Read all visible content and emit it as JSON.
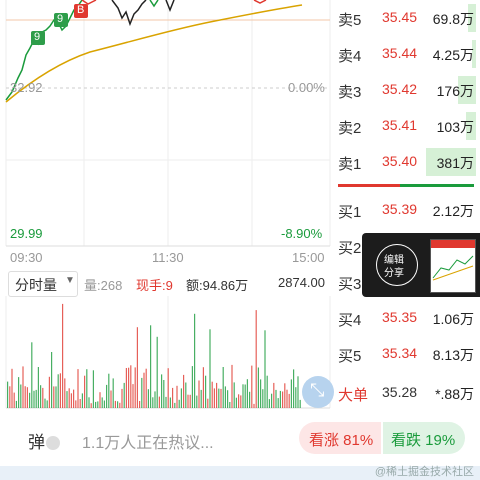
{
  "chart": {
    "left_price_mid": "32.92",
    "right_pct_mid": "0.00%",
    "left_price_low": "29.99",
    "right_pct_low": "-8.90%",
    "marker_9": "9",
    "marker_b": "B",
    "time_labels": [
      "09:30",
      "11:30",
      "15:00"
    ]
  },
  "volume_header": {
    "selector_label": "分时量",
    "vol_label": "量:268",
    "current_hand_label": "现手:9",
    "amount_label": "额:94.86万",
    "max_label": "2874.00"
  },
  "order_book": {
    "asks": [
      {
        "side": "卖5",
        "price": "35.45",
        "volume": "69.8万",
        "bar_fraction": 0.05
      },
      {
        "side": "卖4",
        "price": "35.44",
        "volume": "4.25万",
        "bar_fraction": 0.03
      },
      {
        "side": "卖3",
        "price": "35.42",
        "volume": "176万",
        "bar_fraction": 0.12
      },
      {
        "side": "卖2",
        "price": "35.41",
        "volume": "103万",
        "bar_fraction": 0.07
      },
      {
        "side": "卖1",
        "price": "35.40",
        "volume": "381万",
        "bar_fraction": 0.35
      }
    ],
    "bids": [
      {
        "side": "买1",
        "price": "35.39",
        "volume": "2.12万"
      },
      {
        "side": "买2",
        "price": "",
        "volume": ""
      },
      {
        "side": "买3",
        "price": "",
        "volume": ""
      },
      {
        "side": "买4",
        "price": "35.35",
        "volume": "1.06万"
      },
      {
        "side": "买5",
        "price": "35.34",
        "volume": "8.13万"
      }
    ],
    "big_order": {
      "label": "大单",
      "price": "35.28",
      "volume": "*.88万"
    }
  },
  "popup": {
    "edit_label": "编辑",
    "share_label": "分享"
  },
  "bottom_bar": {
    "danmu_label": "弹",
    "hot_text": "1.1万人正在热议...",
    "bull_label": "看涨 81%",
    "bear_label": "看跌 19%"
  },
  "watermark": "@稀土掘金技术社区",
  "colors": {
    "up": "#e0382f",
    "down": "#1a9b3c",
    "avg_line": "#d9a300",
    "bid_bg": "#d6f0d6"
  }
}
